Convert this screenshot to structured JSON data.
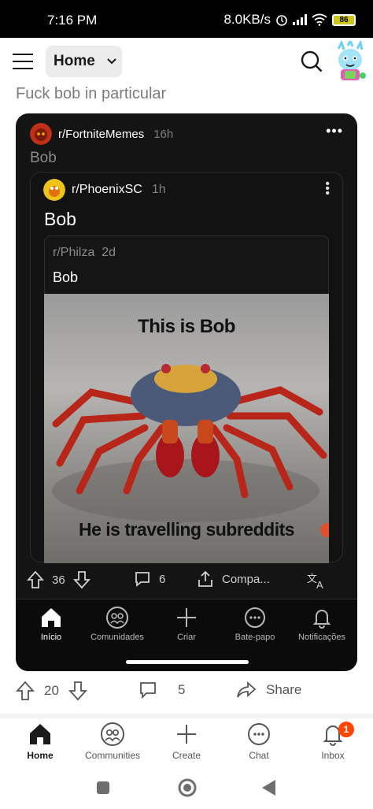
{
  "status_bar": {
    "time": "7:16 PM",
    "net_speed": "8.0KB/s",
    "battery": "86"
  },
  "top_bar": {
    "feed": "Home"
  },
  "post": {
    "title": "Fuck bob in particular"
  },
  "crosspost": {
    "subreddit": "r/FortniteMemes",
    "age": "16h",
    "title": "Bob",
    "inner": {
      "subreddit": "r/PhoenixSC",
      "age": "1h",
      "title": "Bob",
      "nested": {
        "source": "r/Philza",
        "age": "2d",
        "title": "Bob"
      },
      "meme": {
        "top_text": "This is Bob",
        "bottom_text": "He is travelling subreddits"
      }
    },
    "actions": {
      "votes": "36",
      "comments": "6",
      "share": "Compa..."
    },
    "nav": [
      {
        "label": "Início",
        "icon": "home-icon"
      },
      {
        "label": "Comunidades",
        "icon": "communities-icon"
      },
      {
        "label": "Criar",
        "icon": "plus-icon"
      },
      {
        "label": "Bate-papo",
        "icon": "chat-icon"
      },
      {
        "label": "Notificações",
        "icon": "bell-icon"
      }
    ]
  },
  "post_actions": {
    "votes": "20",
    "comments": "5",
    "share": "Share"
  },
  "bottom_nav": [
    {
      "label": "Home",
      "icon": "home-icon"
    },
    {
      "label": "Communities",
      "icon": "communities-icon"
    },
    {
      "label": "Create",
      "icon": "plus-icon"
    },
    {
      "label": "Chat",
      "icon": "chat-icon"
    },
    {
      "label": "Inbox",
      "icon": "bell-icon",
      "badge": "1"
    }
  ],
  "colors": {
    "accent": "#ff4500",
    "card_bg": "#141414",
    "online": "#46d160"
  }
}
